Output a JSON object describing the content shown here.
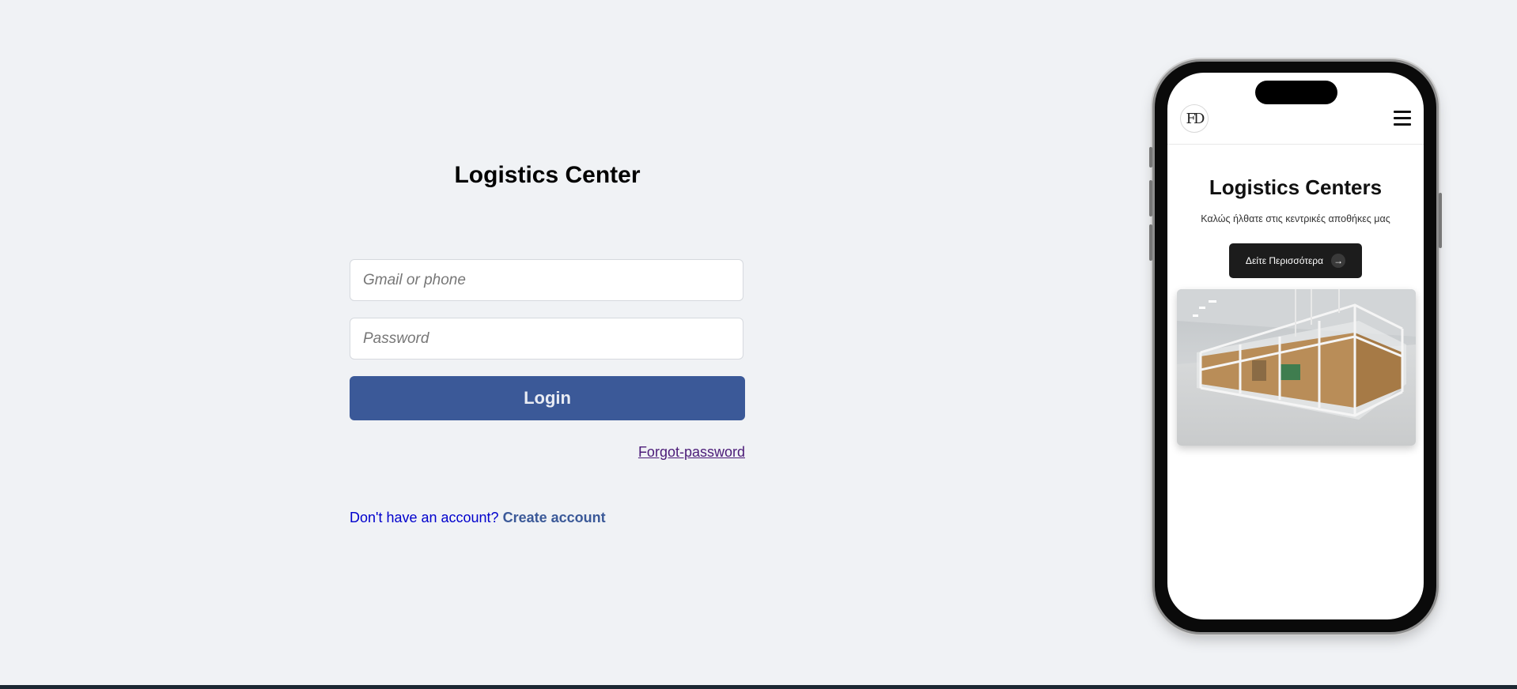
{
  "login": {
    "title": "Logistics Center",
    "email_placeholder": "Gmail or phone",
    "password_placeholder": "Password",
    "login_label": "Login",
    "forgot_label": "Forgot-password",
    "signup_prompt": "Don't have an account?",
    "create_label": "Create account"
  },
  "phone": {
    "logo_text": "FD",
    "title": "Logistics Centers",
    "subtitle": "Καλώς ήλθατε στις κεντρικές αποθήκες μας",
    "cta_label": "Δείτε Περισσότερα",
    "cta_icon": "arrow-right-icon",
    "menu_icon": "hamburger-menu-icon"
  },
  "colors": {
    "background": "#f0f2f5",
    "primary": "#3b5998",
    "link_visited": "#4b1b78",
    "link_text": "#0000cc",
    "footer_bar": "#1c2833"
  }
}
